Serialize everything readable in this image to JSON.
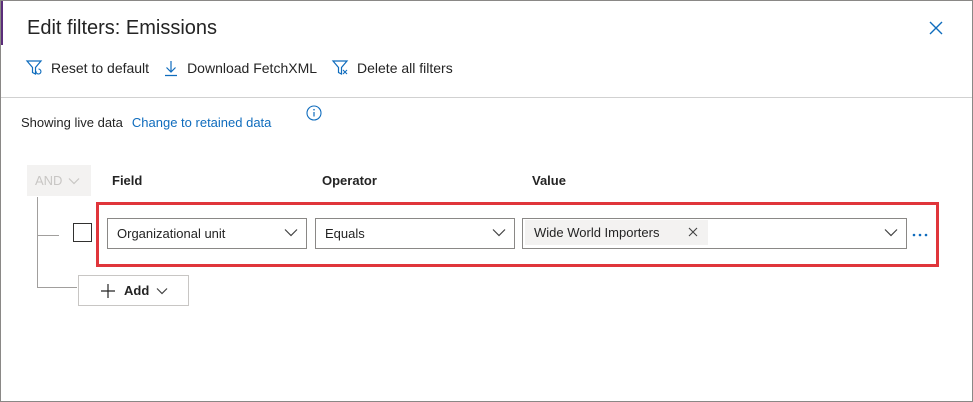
{
  "dialog": {
    "title": "Edit filters: Emissions",
    "accent_color": "#e0353b",
    "link_color": "#0f6cbd"
  },
  "toolbar": {
    "reset_label": "Reset to default",
    "download_label": "Download FetchXML",
    "delete_label": "Delete all filters"
  },
  "data_mode": {
    "status_text": "Showing live data",
    "link_text": "Change to retained data"
  },
  "filter": {
    "group_operator": "AND",
    "columns": {
      "field": "Field",
      "operator": "Operator",
      "value": "Value"
    },
    "rows": [
      {
        "field": "Organizational unit",
        "operator": "Equals",
        "values": [
          "Wide World Importers"
        ]
      }
    ],
    "add_label": "Add"
  },
  "icons": {
    "close": "close-icon",
    "reset": "filter-reset-icon",
    "download": "download-icon",
    "delete": "filter-delete-icon",
    "info": "info-icon",
    "chevron": "chevron-down-icon",
    "more": "more-icon",
    "add": "plus-icon"
  }
}
